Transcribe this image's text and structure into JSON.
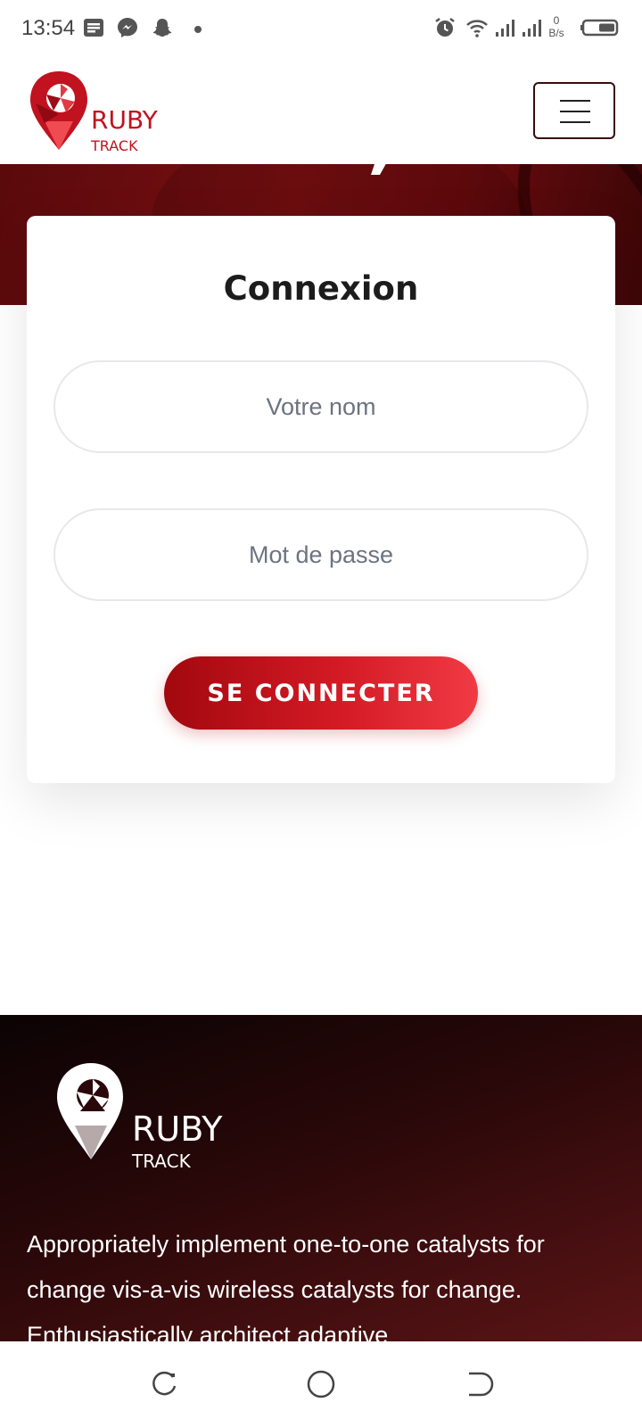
{
  "status_bar": {
    "time": "13:54",
    "speed_value": "0",
    "speed_unit": "B/s",
    "icons": [
      "notes-icon",
      "messenger-icon",
      "snapchat-icon",
      "dot-icon",
      "alarm-icon",
      "wifi-icon",
      "signal-icon",
      "signal-icon-2",
      "battery-icon"
    ]
  },
  "header": {
    "logo_word": "RUBY",
    "logo_sub": "TRACK",
    "menu_icon": "hamburger-icon"
  },
  "login": {
    "title": "Connexion",
    "name_placeholder": "Votre nom",
    "password_placeholder": "Mot de passe",
    "submit_label": "SE CONNECTER"
  },
  "footer": {
    "logo_word": "RUBY",
    "logo_sub": "TRACK",
    "text": "Appropriately implement one-to-one catalysts for change vis-a-vis wireless catalysts for change. Enthusiastically architect adaptive"
  },
  "colors": {
    "brand_red": "#c1121f",
    "button_start": "#a2080f",
    "button_end": "#f03a44",
    "hero_dark": "#5a0a0c",
    "footer_dark": "#0b0304"
  },
  "nav_bar": {
    "icons": [
      "recent-apps-icon",
      "home-icon",
      "back-icon"
    ]
  }
}
